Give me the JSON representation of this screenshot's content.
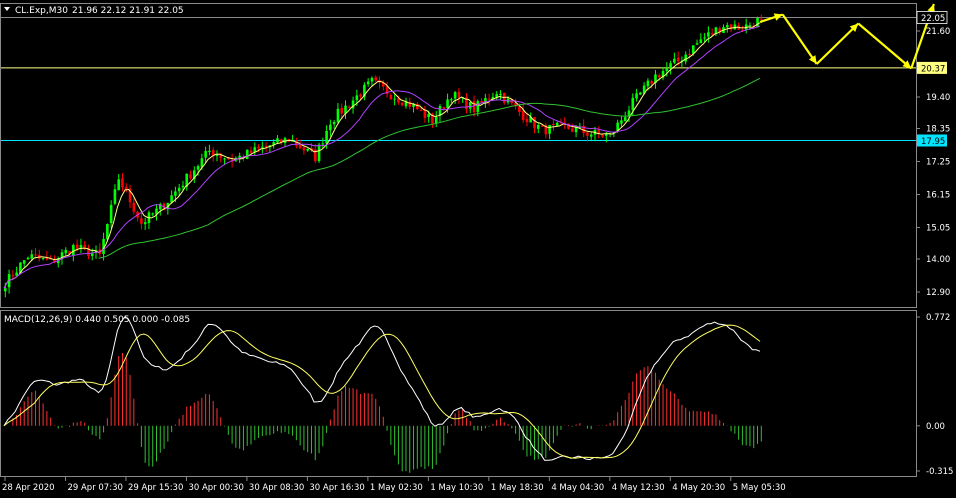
{
  "header": {
    "symbol_label": "CL.Exp,M30",
    "ohlc_label": "21.96 22.12 21.91 22.05"
  },
  "macd_label": "MACD(12,26,9) 0.440 0.505 0.000 -0.085",
  "colors": {
    "background": "#000000",
    "grid_frame": "#8a8a8a",
    "bull_candle": "#00ff00",
    "bear_candle": "#ff0000",
    "ma_fast": "#ffff80",
    "ma_mid": "#b040ff",
    "ma_slow": "#30c030",
    "hline_yellow": "#ffff80",
    "hline_cyan": "#00e5ff",
    "arrow": "#ffff00",
    "macd_line": "#ffffff",
    "signal_line": "#ffff60",
    "hist_up": "#ff3030",
    "hist_down": "#30c030",
    "text": "#ffffff"
  },
  "chart_data": [
    {
      "type": "candlestick",
      "title": "CL.Exp,M30",
      "ylim": [
        12.4,
        22.5
      ],
      "y_ticks": [
        "22.05",
        "21.60",
        "20.37",
        "19.40",
        "18.35",
        "17.95",
        "17.25",
        "16.15",
        "15.05",
        "14.00",
        "12.90"
      ],
      "x_ticks": [
        "28 Apr 2020",
        "29 Apr 07:30",
        "29 Apr 15:30",
        "30 Apr 00:30",
        "30 Apr 08:30",
        "30 Apr 16:30",
        "1 May 02:30",
        "1 May 10:30",
        "1 May 18:30",
        "4 May 04:30",
        "4 May 12:30",
        "4 May 20:30",
        "5 May 05:30"
      ],
      "price_anchors": [
        {
          "bar": 0,
          "close": 13.2
        },
        {
          "bar": 6,
          "close": 14.1
        },
        {
          "bar": 12,
          "close": 13.9
        },
        {
          "bar": 18,
          "close": 14.4
        },
        {
          "bar": 25,
          "close": 14.1
        },
        {
          "bar": 30,
          "close": 16.7
        },
        {
          "bar": 36,
          "close": 15.2
        },
        {
          "bar": 42,
          "close": 15.8
        },
        {
          "bar": 48,
          "close": 16.7
        },
        {
          "bar": 54,
          "close": 17.6
        },
        {
          "bar": 60,
          "close": 17.3
        },
        {
          "bar": 68,
          "close": 17.7
        },
        {
          "bar": 75,
          "close": 18.0
        },
        {
          "bar": 82,
          "close": 17.4
        },
        {
          "bar": 86,
          "close": 18.6
        },
        {
          "bar": 92,
          "close": 19.3
        },
        {
          "bar": 97,
          "close": 19.9
        },
        {
          "bar": 102,
          "close": 19.5
        },
        {
          "bar": 108,
          "close": 19.1
        },
        {
          "bar": 113,
          "close": 18.6
        },
        {
          "bar": 118,
          "close": 19.5
        },
        {
          "bar": 124,
          "close": 19.0
        },
        {
          "bar": 130,
          "close": 19.6
        },
        {
          "bar": 136,
          "close": 18.9
        },
        {
          "bar": 142,
          "close": 18.3
        },
        {
          "bar": 148,
          "close": 18.4
        },
        {
          "bar": 154,
          "close": 18.2
        },
        {
          "bar": 160,
          "close": 18.1
        },
        {
          "bar": 166,
          "close": 19.2
        },
        {
          "bar": 172,
          "close": 20.1
        },
        {
          "bar": 178,
          "close": 20.6
        },
        {
          "bar": 184,
          "close": 21.3
        },
        {
          "bar": 190,
          "close": 21.8
        },
        {
          "bar": 195,
          "close": 21.7
        },
        {
          "bar": 200,
          "close": 22.0
        }
      ],
      "horizontal_lines": [
        {
          "value": 22.05,
          "color": "#8a8a8a",
          "label": "22.05"
        },
        {
          "value": 20.37,
          "color": "#ffff80",
          "label": "20.37"
        },
        {
          "value": 17.95,
          "color": "#00e5ff",
          "label": "17.95"
        }
      ],
      "moving_averages": [
        {
          "period": 5,
          "color": "#ffff80"
        },
        {
          "period": 13,
          "color": "#b040ff"
        },
        {
          "period": 55,
          "color": "#30c030"
        }
      ],
      "projection_path": [
        {
          "bar": 200,
          "value": 21.9
        },
        {
          "bar": 206,
          "value": 22.15
        },
        {
          "bar": 215,
          "value": 20.5
        },
        {
          "bar": 226,
          "value": 21.85
        },
        {
          "bar": 240,
          "value": 20.35
        },
        {
          "bar": 246,
          "value": 22.5
        }
      ]
    },
    {
      "type": "macd",
      "title": "MACD(12,26,9) 0.440 0.505 0.000 -0.085",
      "params": [
        12,
        26,
        9
      ],
      "ylim": [
        -0.35,
        0.8
      ],
      "y_ticks": [
        "0.772",
        "0.00",
        "-0.315"
      ],
      "values": {
        "macd": 0.44,
        "signal": 0.505,
        "zero": 0.0,
        "histogram": -0.085
      }
    }
  ]
}
